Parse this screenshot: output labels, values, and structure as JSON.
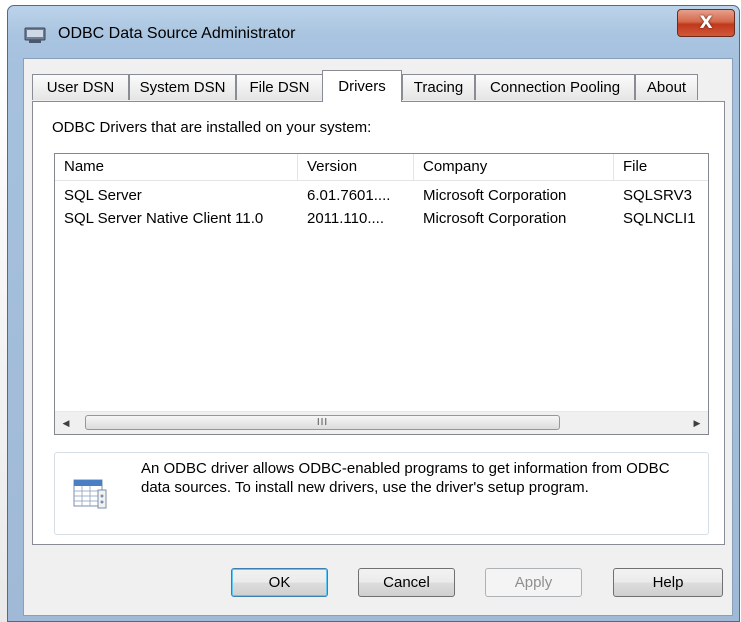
{
  "window": {
    "title": "ODBC Data Source Administrator",
    "close_glyph": "X"
  },
  "tabs": [
    {
      "label": "User DSN"
    },
    {
      "label": "System DSN"
    },
    {
      "label": "File DSN"
    },
    {
      "label": "Drivers",
      "selected": true
    },
    {
      "label": "Tracing"
    },
    {
      "label": "Connection Pooling"
    },
    {
      "label": "About"
    }
  ],
  "drivers_panel": {
    "heading": "ODBC Drivers that are installed on your system:",
    "columns": [
      "Name",
      "Version",
      "Company",
      "File"
    ],
    "rows": [
      [
        "SQL Server",
        "6.01.7601....",
        "Microsoft Corporation",
        "SQLSRV3"
      ],
      [
        "SQL Server Native Client 11.0",
        "2011.110....",
        "Microsoft Corporation",
        "SQLNCLI1"
      ]
    ],
    "scrollbar_thumb_glyph": "III",
    "info_text": "An ODBC driver allows ODBC-enabled programs to get information from ODBC data sources.  To install new drivers, use the driver's setup program."
  },
  "buttons": {
    "ok": "OK",
    "cancel": "Cancel",
    "apply": "Apply",
    "help": "Help"
  },
  "icons": {
    "title_icon": "odbc-admin-icon",
    "info_icon": "datasheet-icon",
    "scroll_left": "scroll-left-arrow-icon",
    "scroll_right": "scroll-right-arrow-icon"
  },
  "colors": {
    "title_bar": "#a9c4e0",
    "close_button": "#c0391d",
    "default_button_border": "#3c7fb1"
  }
}
